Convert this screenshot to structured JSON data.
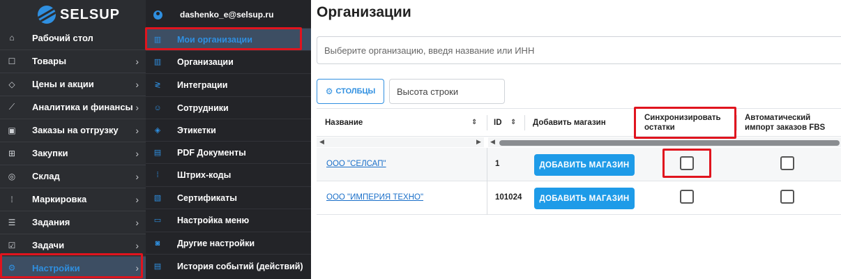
{
  "brand": {
    "name": "SELSUP"
  },
  "sidebar": {
    "items": [
      {
        "label": "Рабочий стол",
        "icon": "home-icon"
      },
      {
        "label": "Товары",
        "icon": "bag-icon"
      },
      {
        "label": "Цены и акции",
        "icon": "tag-icon"
      },
      {
        "label": "Аналитика и финансы",
        "icon": "chart-icon"
      },
      {
        "label": "Заказы на отгрузку",
        "icon": "box-icon"
      },
      {
        "label": "Закупки",
        "icon": "cart-icon"
      },
      {
        "label": "Склад",
        "icon": "check-circle-icon"
      },
      {
        "label": "Маркировка",
        "icon": "barcode-icon"
      },
      {
        "label": "Задания",
        "icon": "list-icon"
      },
      {
        "label": "Задачи",
        "icon": "calendar-check-icon"
      },
      {
        "label": "Настройки",
        "icon": "gear-icon"
      }
    ]
  },
  "submenu": {
    "user": "dashenko_e@selsup.ru",
    "items": [
      {
        "label": "Мои организации",
        "icon": "building-icon"
      },
      {
        "label": "Организации",
        "icon": "building-icon"
      },
      {
        "label": "Интеграции",
        "icon": "plug-icon"
      },
      {
        "label": "Сотрудники",
        "icon": "user-icon"
      },
      {
        "label": "Этикетки",
        "icon": "label-icon"
      },
      {
        "label": "PDF Документы",
        "icon": "document-icon"
      },
      {
        "label": "Штрих-коды",
        "icon": "barcode-scan-icon"
      },
      {
        "label": "Сертификаты",
        "icon": "certificate-icon"
      },
      {
        "label": "Настройка меню",
        "icon": "menu-icon"
      },
      {
        "label": "Другие настройки",
        "icon": "settings-icon"
      },
      {
        "label": "История событий (действий)",
        "icon": "history-icon"
      }
    ]
  },
  "main": {
    "title": "Организации",
    "search_placeholder": "Выберите организацию, введя название или ИНН",
    "columns_button": "СТОЛБЦЫ",
    "row_height_label": "Высота строки",
    "table": {
      "headers": {
        "name": "Название",
        "id": "ID",
        "add_shop": "Добавить магазин",
        "sync": "Синхронизировать остатки",
        "auto_import": "Автоматический импорт заказов FBS"
      },
      "rows": [
        {
          "name": "ООО \"СЕЛСАП\"",
          "id": "1",
          "button": "ДОБАВИТЬ МАГАЗИН",
          "sync": false,
          "auto_import": false
        },
        {
          "name": "ООО \"ИМПЕРИЯ ТЕХНО\"",
          "id": "101024",
          "button": "ДОБАВИТЬ МАГАЗИН",
          "sync": false,
          "auto_import": false
        }
      ]
    }
  },
  "colors": {
    "accent": "#2f8fe0",
    "highlight": "#e0141e",
    "sidebar_bg": "#2b2d31",
    "button_bg": "#1e9be8"
  }
}
